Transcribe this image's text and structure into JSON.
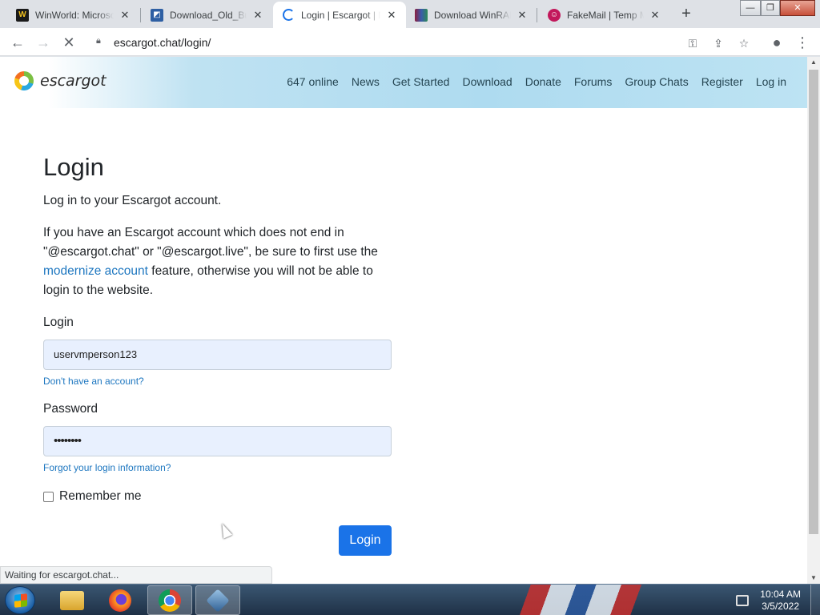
{
  "browser": {
    "tabs": [
      {
        "title": "WinWorld: Microsoft",
        "favicon": "winworld-icon",
        "active": false
      },
      {
        "title": "Download_Old_Builds",
        "favicon": "download-site-icon",
        "active": false
      },
      {
        "title": "Login | Escargot | MSN",
        "favicon": "loading-spinner-icon",
        "active": true
      },
      {
        "title": "Download WinRAR",
        "favicon": "winrar-icon",
        "active": false
      },
      {
        "title": "FakeMail | Temp Mail",
        "favicon": "fakemail-icon",
        "active": false
      }
    ],
    "url": "escargot.chat/login/",
    "status": "Waiting for escargot.chat..."
  },
  "site": {
    "logo_text": "escargot",
    "nav": [
      "647 online",
      "News",
      "Get Started",
      "Download",
      "Donate",
      "Forums",
      "Group Chats",
      "Register",
      "Log in"
    ]
  },
  "page": {
    "title": "Login",
    "intro": "Log in to your Escargot account.",
    "notice_before": "If you have an Escargot account which does not end in \"@escargot.chat\" or \"@escargot.live\", be sure to first use the ",
    "notice_link": "modernize account",
    "notice_after": " feature, otherwise you will not be able to login to the website.",
    "login_label": "Login",
    "login_value": "uservmperson123",
    "no_account_link": "Don't have an account?",
    "password_label": "Password",
    "password_value": "••••••••",
    "forgot_link": "Forgot your login information?",
    "remember_label": "Remember me",
    "submit_label": "Login"
  },
  "taskbar": {
    "time": "10:04 AM",
    "date": "3/5/2022"
  },
  "colors": {
    "accent": "#1a73e8",
    "link": "#1e77c0",
    "header_blue": "#aedbf0"
  }
}
